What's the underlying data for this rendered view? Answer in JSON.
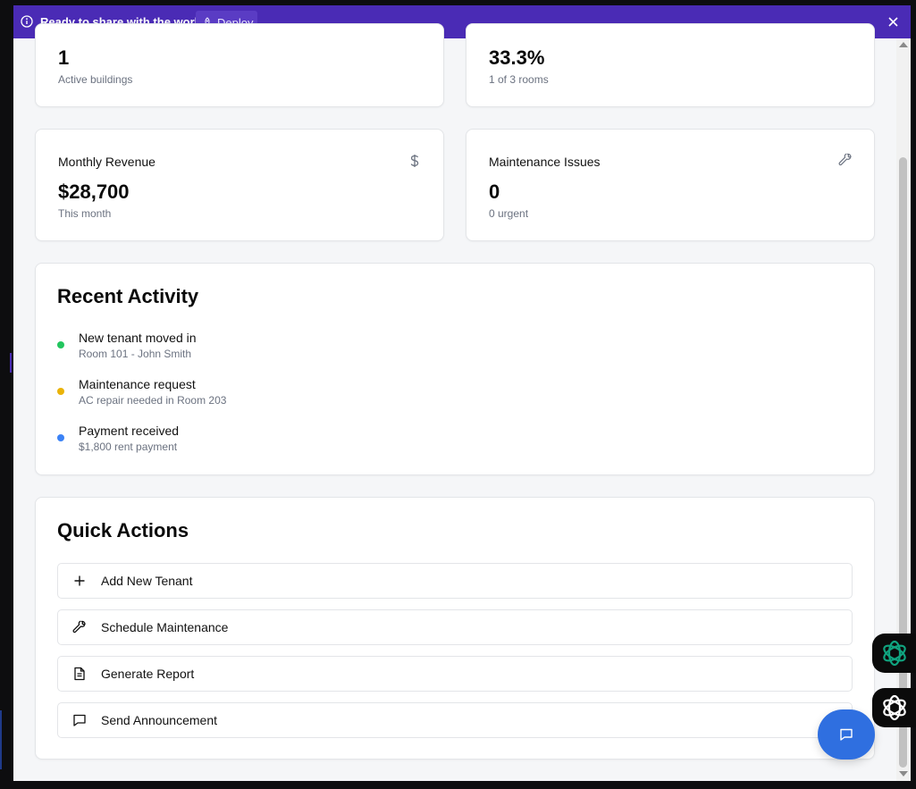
{
  "banner": {
    "message": "Ready to share with the world?",
    "deploy_label": "Deploy",
    "bg_color": "#4a2bb5"
  },
  "stats": [
    {
      "value": "1",
      "subtitle": "Active buildings"
    },
    {
      "value": "33.3%",
      "subtitle": "1 of 3 rooms"
    },
    {
      "title": "Monthly Revenue",
      "value": "$28,700",
      "subtitle": "This month",
      "icon": "dollar-icon"
    },
    {
      "title": "Maintenance Issues",
      "value": "0",
      "subtitle": "0 urgent",
      "icon": "wrench-icon"
    }
  ],
  "recent_activity": {
    "title": "Recent Activity",
    "items": [
      {
        "title": "New tenant moved in",
        "subtitle": "Room 101 - John Smith",
        "color": "#22c55e"
      },
      {
        "title": "Maintenance request",
        "subtitle": "AC repair needed in Room 203",
        "color": "#eab308"
      },
      {
        "title": "Payment received",
        "subtitle": "$1,800 rent payment",
        "color": "#3b82f6"
      }
    ]
  },
  "quick_actions": {
    "title": "Quick Actions",
    "items": [
      {
        "label": "Add New Tenant",
        "icon": "plus-icon"
      },
      {
        "label": "Schedule Maintenance",
        "icon": "wrench-icon"
      },
      {
        "label": "Generate Report",
        "icon": "document-icon"
      },
      {
        "label": "Send Announcement",
        "icon": "message-icon"
      }
    ]
  },
  "chat_fab": {
    "icon": "chat-bubble-icon",
    "color": "#2f6fe0"
  },
  "extensions": [
    {
      "icon": "chatgpt-icon",
      "color": "#10a37f"
    },
    {
      "icon": "openai-icon",
      "color": "#ffffff"
    }
  ]
}
